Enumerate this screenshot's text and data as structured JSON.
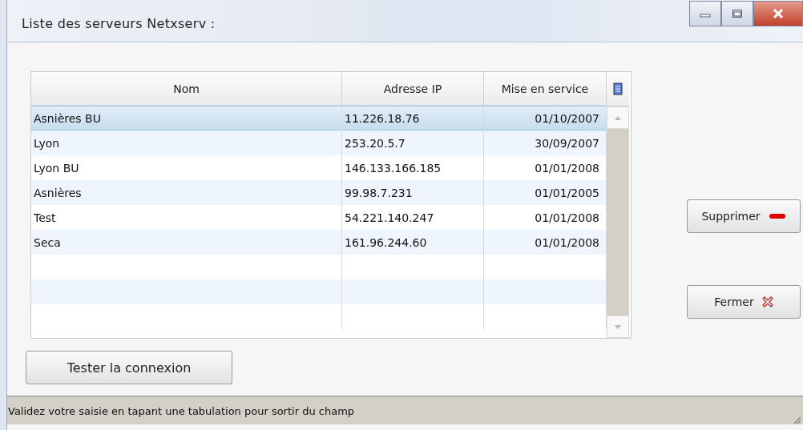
{
  "window": {
    "title": "Liste des serveurs Netxserv :"
  },
  "table": {
    "columns": [
      "Nom",
      "Adresse IP",
      "Mise en service"
    ],
    "rows": [
      {
        "cells": [
          "Asnières BU",
          "11.226.18.76",
          "01/10/2007"
        ],
        "selected": true
      },
      {
        "cells": [
          "Lyon",
          "253.20.5.7",
          "30/09/2007"
        ],
        "selected": false
      },
      {
        "cells": [
          "Lyon BU",
          "146.133.166.185",
          "01/01/2008"
        ],
        "selected": false
      },
      {
        "cells": [
          "Asnières",
          "99.98.7.231",
          "01/01/2005"
        ],
        "selected": false
      },
      {
        "cells": [
          "Test",
          "54.221.140.247",
          "01/01/2008"
        ],
        "selected": false
      },
      {
        "cells": [
          "Seca",
          "161.96.244.60",
          "01/01/2008"
        ],
        "selected": false
      }
    ]
  },
  "buttons": [
    {
      "label": "Tester la connexion",
      "kind": "plain"
    },
    {
      "label": "Supprimer",
      "kind": "delete"
    },
    {
      "label": "Fermer",
      "kind": "close"
    }
  ],
  "status_bar": "Validez votre saisie en tapant une tabulation pour sortir du champ"
}
